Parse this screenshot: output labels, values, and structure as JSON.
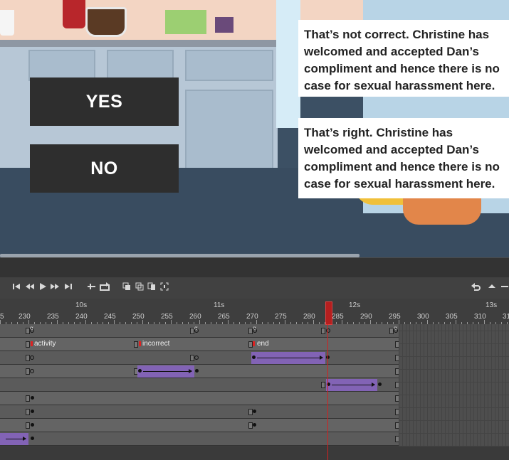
{
  "stage": {
    "buttons": {
      "yes": "YES",
      "no": "NO"
    },
    "feedback_incorrect": "That’s not correct. Christine has welcomed and accepted Dan’s compliment and hence there is no case for sexual harassment here.",
    "feedback_correct": "That’s right. Christine has welcomed and accepted Dan’s compliment and hence there is no case for sexual harassment here."
  },
  "timeline": {
    "toolbar_icons": [
      "first-frame-icon",
      "step-back-icon",
      "play-icon",
      "step-forward-icon",
      "last-frame-icon",
      "loop-icon",
      "sync-icon",
      "onion-skin-icon",
      "onion-outline-icon",
      "edit-multiple-icon",
      "center-frame-icon",
      "undo-icon",
      "collapse-icon",
      "panel-menu-icon"
    ],
    "seconds": [
      "10s",
      "11s",
      "12s",
      "13s"
    ],
    "frame_numbers": [
      "5",
      "230",
      "235",
      "240",
      "245",
      "250",
      "255",
      "260",
      "265",
      "270",
      "275",
      "280",
      "285",
      "290",
      "295",
      "300",
      "305",
      "310",
      "31"
    ],
    "current_frame": 286,
    "frame_labels": {
      "activity": "activity",
      "incorrect": "incorrect",
      "end": "end"
    },
    "action_glyph": "α"
  },
  "colors": {
    "tween": "#8263b5",
    "playhead": "#d32020",
    "stage_button": "#2e2e2e"
  }
}
